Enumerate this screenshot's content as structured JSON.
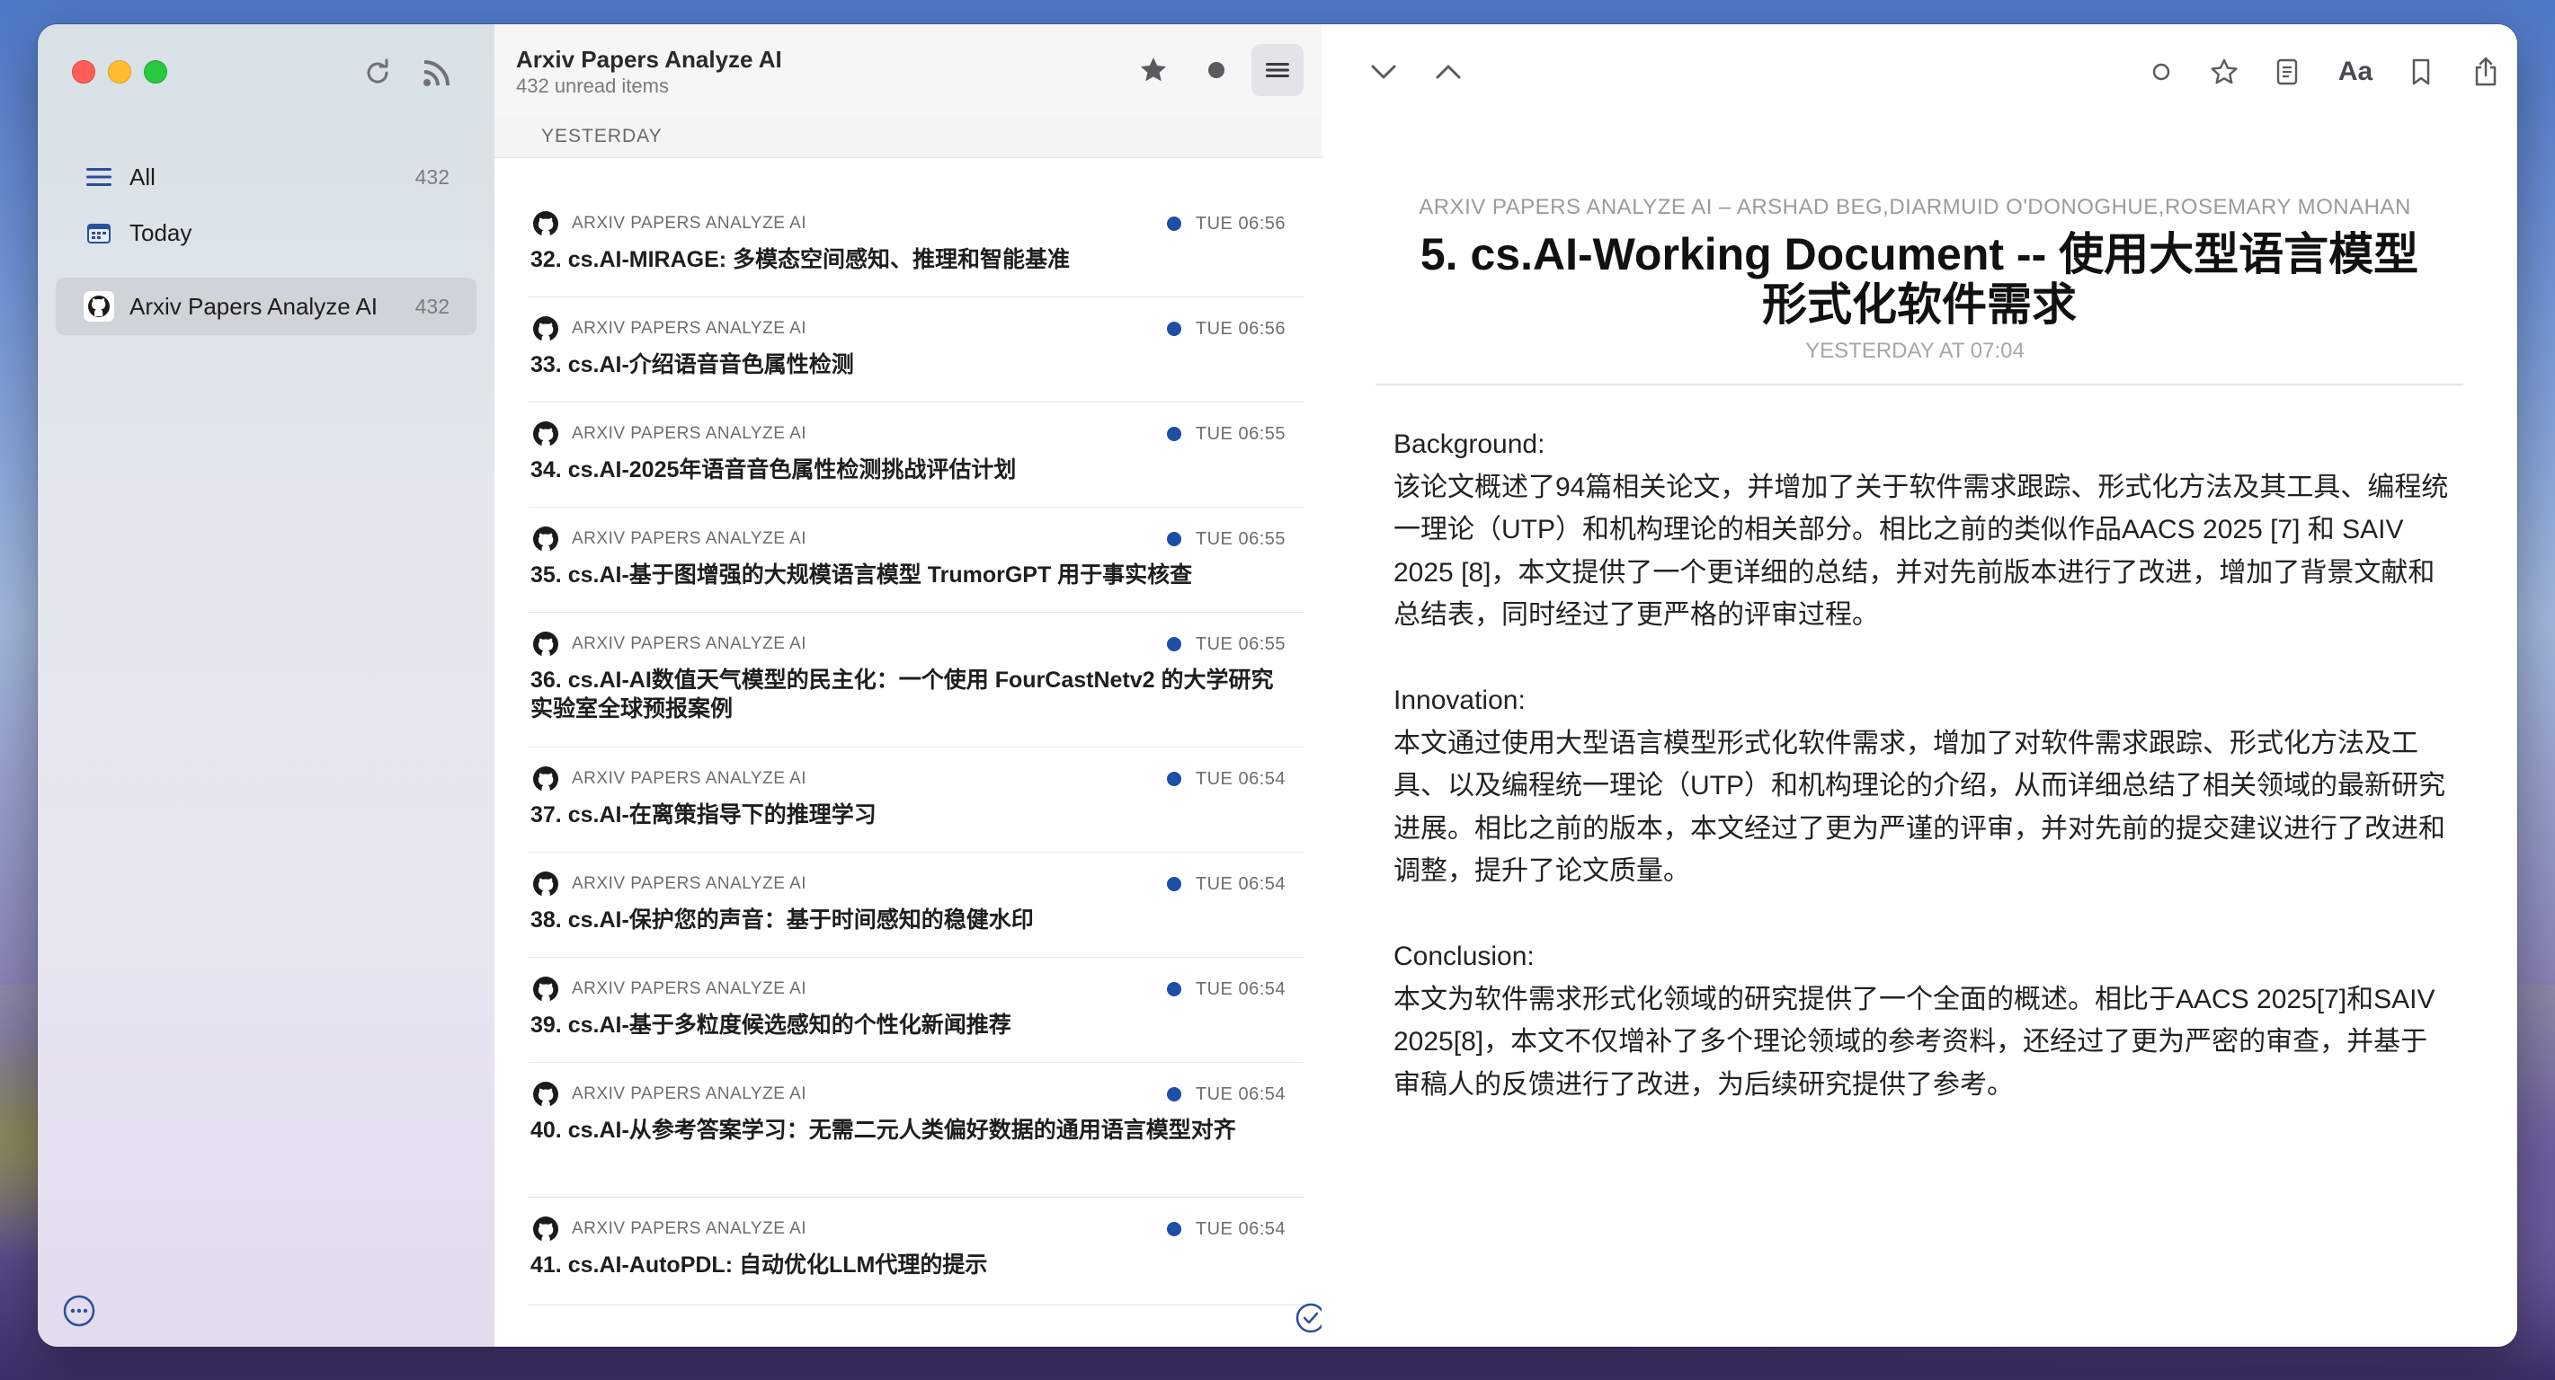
{
  "sidebar": {
    "items": [
      {
        "label": "All",
        "count": "432",
        "icon": "list-icon"
      },
      {
        "label": "Today",
        "count": "",
        "icon": "calendar-icon"
      }
    ],
    "feeds": [
      {
        "label": "Arxiv Papers Analyze AI",
        "count": "432",
        "icon": "github-icon"
      }
    ]
  },
  "list": {
    "title": "Arxiv Papers Analyze AI",
    "subtitle": "432 unread items",
    "section": "YESTERDAY",
    "items": [
      {
        "source": "ARXIV PAPERS ANALYZE AI",
        "time": "TUE 06:56",
        "title": "32. cs.AI-MIRAGE: 多模态空间感知、推理和智能基准"
      },
      {
        "source": "ARXIV PAPERS ANALYZE AI",
        "time": "TUE 06:56",
        "title": "33. cs.AI-介绍语音音色属性检测"
      },
      {
        "source": "ARXIV PAPERS ANALYZE AI",
        "time": "TUE 06:55",
        "title": "34. cs.AI-2025年语音音色属性检测挑战评估计划"
      },
      {
        "source": "ARXIV PAPERS ANALYZE AI",
        "time": "TUE 06:55",
        "title": "35. cs.AI-基于图增强的大规模语言模型 TrumorGPT 用于事实核查"
      },
      {
        "source": "ARXIV PAPERS ANALYZE AI",
        "time": "TUE 06:55",
        "title": "36. cs.AI-AI数值天气模型的民主化：一个使用 FourCastNetv2 的大学研究实验室全球预报案例"
      },
      {
        "source": "ARXIV PAPERS ANALYZE AI",
        "time": "TUE 06:54",
        "title": "37. cs.AI-在离策指导下的推理学习"
      },
      {
        "source": "ARXIV PAPERS ANALYZE AI",
        "time": "TUE 06:54",
        "title": "38. cs.AI-保护您的声音：基于时间感知的稳健水印"
      },
      {
        "source": "ARXIV PAPERS ANALYZE AI",
        "time": "TUE 06:54",
        "title": "39. cs.AI-基于多粒度候选感知的个性化新闻推荐"
      },
      {
        "source": "ARXIV PAPERS ANALYZE AI",
        "time": "TUE 06:54",
        "title": "40. cs.AI-从参考答案学习：无需二元人类偏好数据的通用语言模型对齐"
      },
      {
        "source": "ARXIV PAPERS ANALYZE AI",
        "time": "TUE 06:54",
        "title": "41. cs.AI-AutoPDL: 自动优化LLM代理的提示"
      }
    ]
  },
  "reader": {
    "authors": "ARXIV PAPERS ANALYZE AI – ARSHAD BEG,DIARMUID O'DONOGHUE,ROSEMARY MONAHAN",
    "title": "5. cs.AI-Working Document -- 使用大型语言模型形式化软件需求",
    "date": "YESTERDAY AT 07:04",
    "sections": [
      {
        "heading": "Background:",
        "text": "该论文概述了94篇相关论文，并增加了关于软件需求跟踪、形式化方法及其工具、编程统一理论（UTP）和机构理论的相关部分。相比之前的类似作品AACS 2025 [7] 和 SAIV 2025 [8]，本文提供了一个更详细的总结，并对先前版本进行了改进，增加了背景文献和总结表，同时经过了更严格的评审过程。"
      },
      {
        "heading": "Innovation:",
        "text": "本文通过使用大型语言模型形式化软件需求，增加了对软件需求跟踪、形式化方法及工具、以及编程统一理论（UTP）和机构理论的介绍，从而详细总结了相关领域的最新研究进展。相比之前的版本，本文经过了更为严谨的评审，并对先前的提交建议进行了改进和调整，提升了论文质量。"
      },
      {
        "heading": "Conclusion:",
        "text": "本文为软件需求形式化领域的研究提供了一个全面的概述。相比于AACS 2025[7]和SAIV 2025[8]，本文不仅增补了多个理论领域的参考资料，还经过了更为严密的审查，并基于审稿人的反馈进行了改进，为后续研究提供了参考。"
      }
    ]
  },
  "colors": {
    "accent": "#1c4fa6",
    "selected": "#cfd3da"
  }
}
